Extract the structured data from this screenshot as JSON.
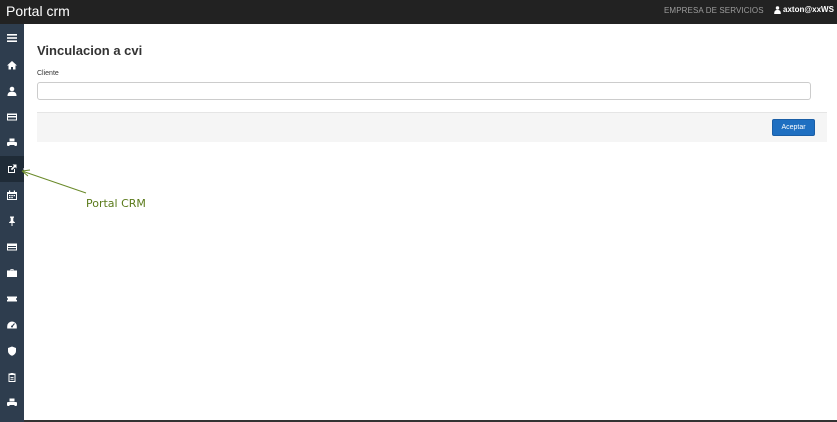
{
  "header": {
    "brand": "Portal crm",
    "company": "EMPRESA DE SERVICIOS",
    "user": "axton@xxWS"
  },
  "sidebar": {
    "items": [
      {
        "icon": "menu-icon"
      },
      {
        "icon": "home-icon"
      },
      {
        "icon": "user-icon"
      },
      {
        "icon": "credit-card-icon"
      },
      {
        "icon": "print-icon"
      },
      {
        "icon": "external-link-icon",
        "active": true
      },
      {
        "icon": "calendar-icon"
      },
      {
        "icon": "pin-icon"
      },
      {
        "icon": "list-icon"
      },
      {
        "icon": "briefcase-icon"
      },
      {
        "icon": "ticket-icon"
      },
      {
        "icon": "dashboard-icon"
      },
      {
        "icon": "shield-icon"
      },
      {
        "icon": "clipboard-icon"
      },
      {
        "icon": "print-icon"
      }
    ]
  },
  "main": {
    "title": "Vinculacion a cvi",
    "client_label": "Cliente",
    "client_value": "",
    "accept_label": "Aceptar"
  },
  "annotation": {
    "label": "Portal CRM",
    "color": "#5a7a1a"
  },
  "colors": {
    "topbar": "#222222",
    "sidebar": "#2e3d4e",
    "primary_button": "#1f6fc1"
  }
}
